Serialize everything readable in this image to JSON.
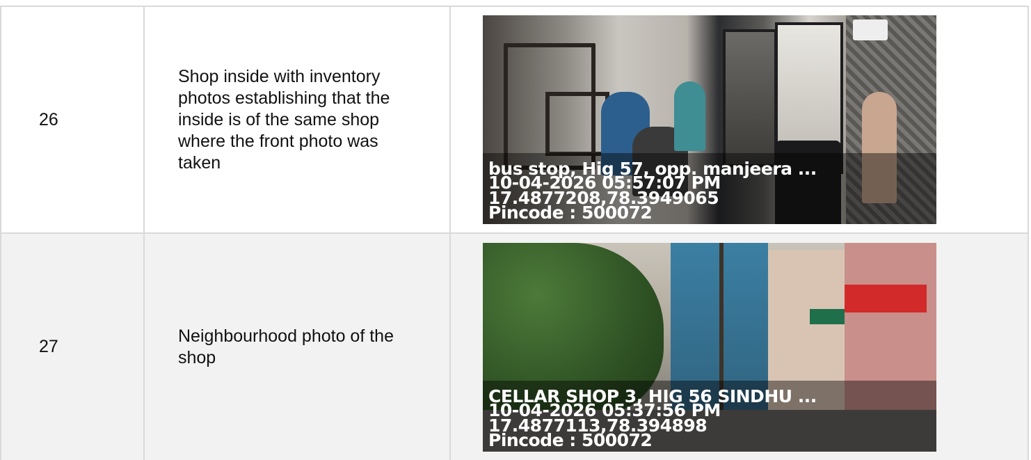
{
  "rows": [
    {
      "sno": "26",
      "description": "Shop inside with inventory photos establishing that the inside is of the same shop where the front photo was taken",
      "stamp": {
        "address": "bus stop, Hig 57, opp. manjeera ...",
        "datetime": "10-04-2026 05:57:07 PM",
        "coords": "17.4877208,78.3949065",
        "pincode": "Pincode : 500072"
      }
    },
    {
      "sno": "27",
      "description": "Neighbourhood photo of the shop",
      "stamp": {
        "address": "CELLAR SHOP 3, HIG 56 SINDHU ...",
        "datetime": "10-04-2026 05:37:56 PM",
        "coords": "17.4877113,78.394898",
        "pincode": "Pincode : 500072"
      }
    }
  ]
}
